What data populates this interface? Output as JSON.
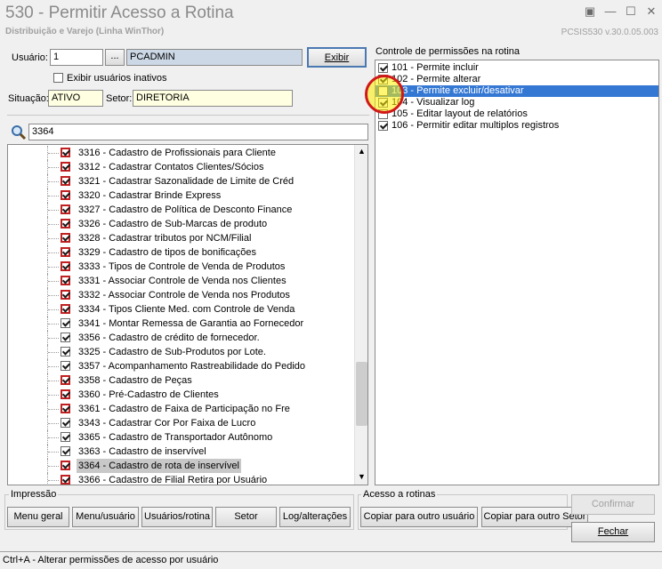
{
  "window": {
    "title": "530 - Permitir Acesso a Rotina",
    "subtitle": "Distribuição e Varejo (Linha WinThor)",
    "version": "PCSIS530  v.30.0.05.003"
  },
  "user": {
    "label": "Usuário:",
    "id": "1",
    "browse_label": "...",
    "name": "PCADMIN",
    "show_button": "Exibir",
    "inactive_checkbox_label": "Exibir usuários inativos",
    "situation_label": "Situação:",
    "situation_value": "ATIVO",
    "sector_label": "Setor:",
    "sector_value": "DIRETORIA"
  },
  "search": {
    "value": "3364"
  },
  "routines": [
    {
      "label": "3316 - Cadastro de Profissionais para Cliente",
      "checked": true,
      "red": true
    },
    {
      "label": "3312 - Cadastrar Contatos Clientes/Sócios",
      "checked": true,
      "red": true
    },
    {
      "label": "3321 - Cadastrar Sazonalidade de Limite de Créd",
      "checked": true,
      "red": true
    },
    {
      "label": "3320 - Cadastrar Brinde Express",
      "checked": true,
      "red": true
    },
    {
      "label": "3327 - Cadastro de Política de Desconto Finance",
      "checked": true,
      "red": true
    },
    {
      "label": "3326 - Cadastro de Sub-Marcas de produto",
      "checked": true,
      "red": true
    },
    {
      "label": "3328 - Cadastrar tributos por NCM/Filial",
      "checked": true,
      "red": true
    },
    {
      "label": "3329 - Cadastro de tipos de bonificações",
      "checked": true,
      "red": true
    },
    {
      "label": "3333 - Tipos de Controle de Venda de Produtos",
      "checked": true,
      "red": true
    },
    {
      "label": "3331 - Associar Controle de Venda nos Clientes",
      "checked": true,
      "red": true
    },
    {
      "label": "3332 - Associar Controle de Venda nos Produtos",
      "checked": true,
      "red": true
    },
    {
      "label": "3334 - Tipos Cliente Med. com Controle de Venda",
      "checked": true,
      "red": true
    },
    {
      "label": "3341 - Montar Remessa de Garantia ao Fornecedor",
      "checked": true,
      "red": false
    },
    {
      "label": "3356 - Cadastro de crédito de fornecedor.",
      "checked": true,
      "red": false
    },
    {
      "label": "3325 - Cadastro de Sub-Produtos por Lote.",
      "checked": true,
      "red": false
    },
    {
      "label": "3357 - Acompanhamento Rastreabilidade do Pedido",
      "checked": true,
      "red": false
    },
    {
      "label": "3358 - Cadastro de Peças",
      "checked": true,
      "red": true
    },
    {
      "label": "3360 - Pré-Cadastro de Clientes",
      "checked": true,
      "red": true
    },
    {
      "label": "3361 - Cadastro de Faixa de Participação no Fre",
      "checked": true,
      "red": true
    },
    {
      "label": "3343 - Cadastrar Cor Por Faixa de Lucro",
      "checked": true,
      "red": false
    },
    {
      "label": "3365 - Cadastro de Transportador Autônomo",
      "checked": true,
      "red": false
    },
    {
      "label": "3363 - Cadastro de inservível",
      "checked": true,
      "red": false
    },
    {
      "label": "3364 - Cadastro de rota de inservível",
      "checked": true,
      "red": true,
      "selected": true
    },
    {
      "label": "3366 - Cadastro de Filial Retira por Usuário",
      "checked": true,
      "red": true
    }
  ],
  "permissions": {
    "title": "Controle de permissões na rotina",
    "items": [
      {
        "label": "101 - Permite incluir",
        "checked": true
      },
      {
        "label": "102 - Permite alterar",
        "checked": true
      },
      {
        "label": "103 - Permite excluir/desativar",
        "checked": false,
        "selected": true
      },
      {
        "label": "104 - Visualizar log",
        "checked": true
      },
      {
        "label": "105 - Editar layout de relatórios",
        "checked": false
      },
      {
        "label": "106 - Permitir editar multiplos registros",
        "checked": true
      }
    ]
  },
  "printing": {
    "title": "Impressão",
    "buttons": [
      "Menu geral",
      "Menu/usuário",
      "Usuários/rotina",
      "Setor",
      "Log/alterações"
    ]
  },
  "access": {
    "title": "Acesso a rotinas",
    "copy_user": "Copiar para outro usuário",
    "copy_sector": "Copiar para outro Setor"
  },
  "actions": {
    "confirm": "Confirmar",
    "close": "Fechar"
  },
  "statusbar": {
    "text": "Ctrl+A - Alterar permissões de acesso por usuário"
  },
  "colors": {
    "selection_blue": "#3478d4",
    "readonly_field": "#ccd8e6",
    "yellow_field": "#ffffe1",
    "red_checkbox": "#c02020"
  }
}
